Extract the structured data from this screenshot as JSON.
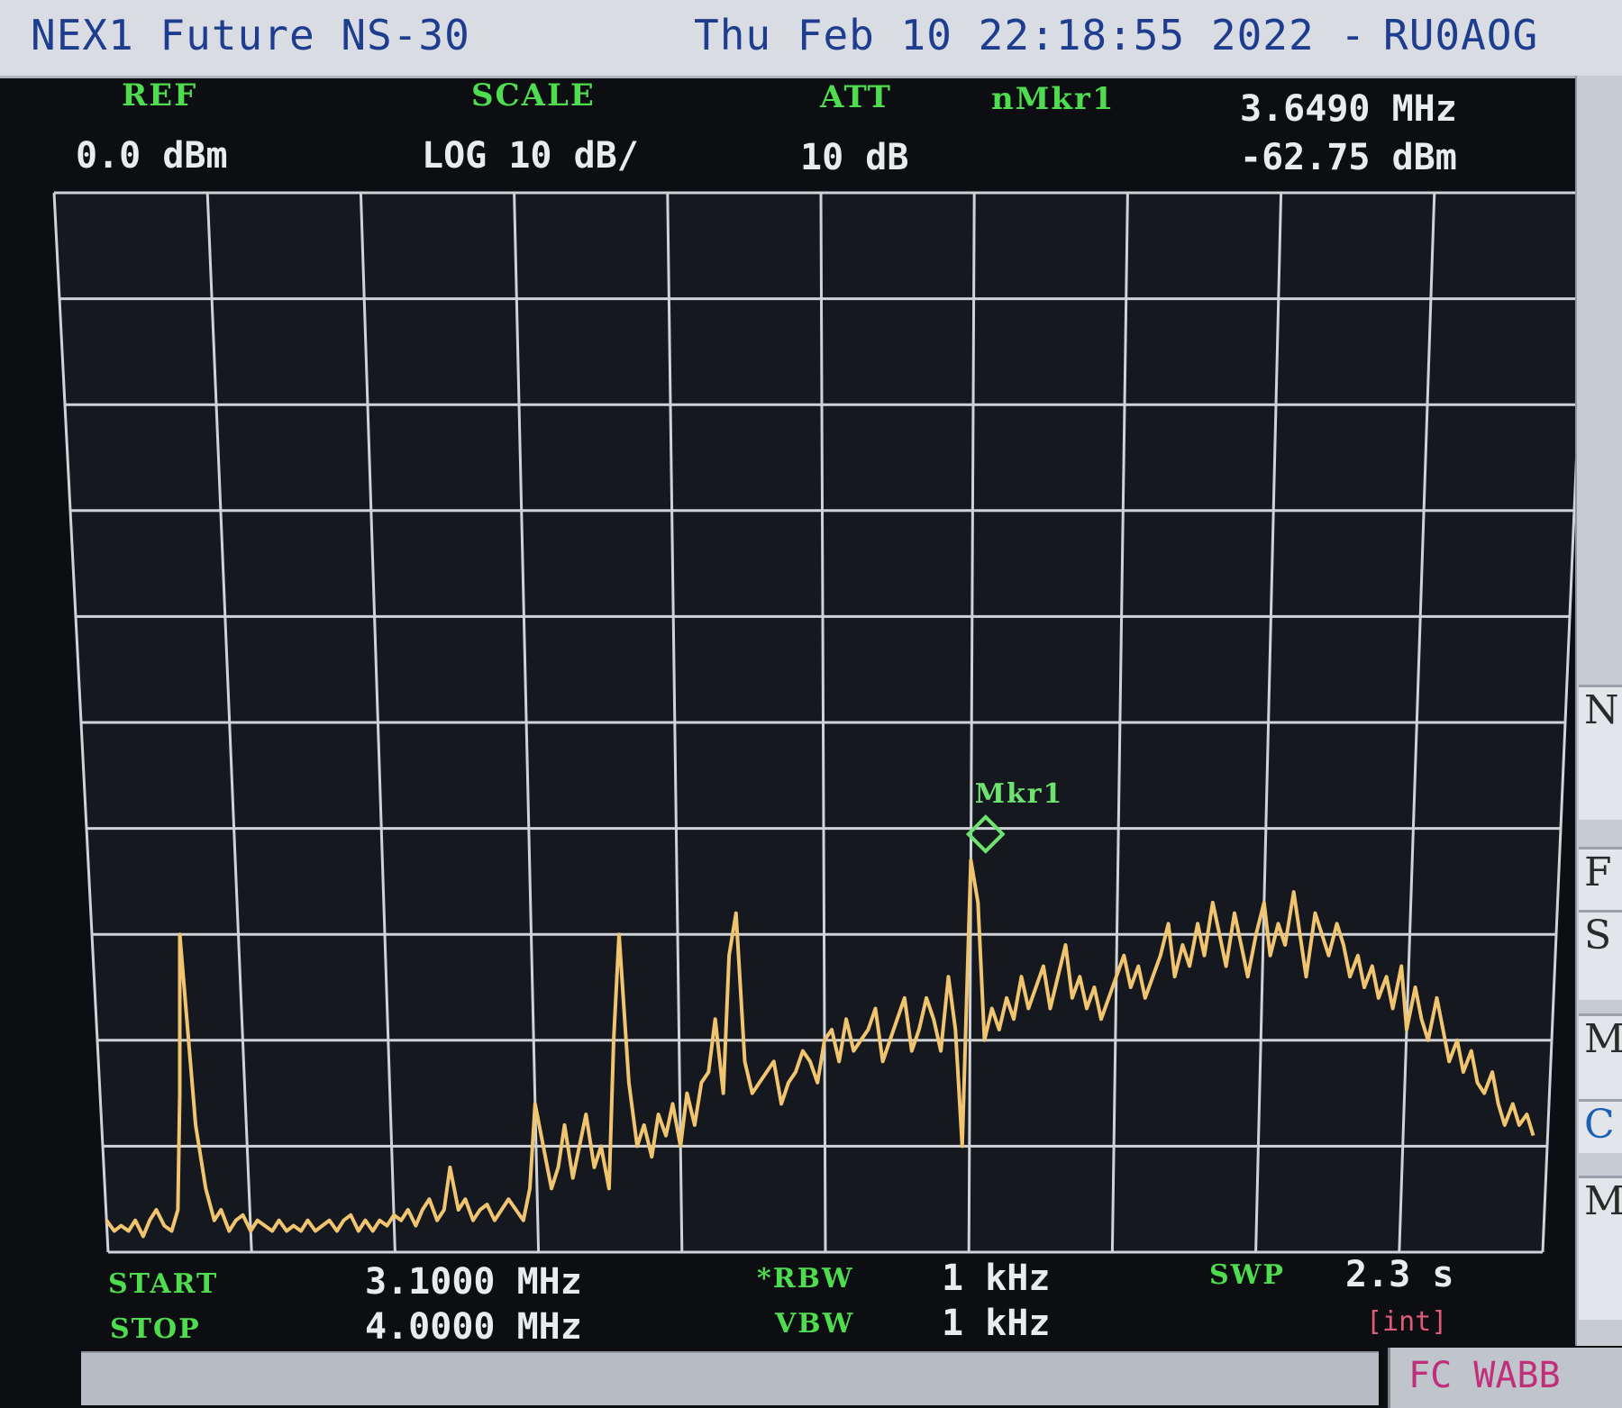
{
  "window": {
    "model": "NEX1 Future NS-30",
    "datetime": "Thu Feb 10 22:18:55 2022 -",
    "callsign": "RU0AOG"
  },
  "header": {
    "ref_label": "REF",
    "ref_value": "0.0 dBm",
    "scale_label": "SCALE",
    "scale_value": "LOG 10 dB/",
    "att_label": "ATT",
    "att_value": "10 dB",
    "marker_label": "nMkr1",
    "marker_freq": "3.6490 MHz",
    "marker_level": "-62.75 dBm"
  },
  "footer": {
    "start_label": "START",
    "start_value": "3.1000 MHz",
    "stop_label": "STOP",
    "stop_value": "4.0000 MHz",
    "rbw_label": "*RBW",
    "rbw_value": "1 kHz",
    "vbw_label": "VBW",
    "vbw_value": "1 kHz",
    "swp_label": "SWP",
    "swp_value": "2.3 s",
    "swp_mode": "[int]"
  },
  "softkeys": [
    "N",
    "F",
    "S",
    "M",
    "C",
    "Mo"
  ],
  "status_box": "FC WABB",
  "marker_tag": "Mkr1",
  "colors": {
    "trace": "#f1c470",
    "grid": "#cfd3d8",
    "label_green": "#4fdc4f",
    "marker": "#6fe36f"
  },
  "chart_data": {
    "type": "line",
    "x_unit": "MHz",
    "y_unit": "dBm",
    "xlim": [
      3.1,
      4.0
    ],
    "ylim": [
      -100,
      0
    ],
    "grid": true,
    "x": [
      3.1,
      3.1045,
      3.109,
      3.1135,
      3.118,
      3.1225,
      3.127,
      3.1315,
      3.136,
      3.1405,
      3.145,
      3.1495,
      3.154,
      3.1585,
      3.163,
      3.1675,
      3.172,
      3.1765,
      3.181,
      3.1855,
      3.19,
      3.1945,
      3.199,
      3.2035,
      3.208,
      3.2125,
      3.217,
      3.2215,
      3.226,
      3.2305,
      3.235,
      3.2395,
      3.244,
      3.2485,
      3.253,
      3.2575,
      3.262,
      3.2665,
      3.271,
      3.2755,
      3.28,
      3.2845,
      3.289,
      3.2935,
      3.298,
      3.3025,
      3.307,
      3.3115,
      3.316,
      3.3205,
      3.325,
      3.3295,
      3.334,
      3.3385,
      3.343,
      3.3475,
      3.352,
      3.3565,
      3.361,
      3.3655,
      3.37,
      3.3745,
      3.379,
      3.3835,
      3.388,
      3.3925,
      3.397,
      3.4015,
      3.406,
      3.4105,
      3.415,
      3.4195,
      3.424,
      3.4285,
      3.433,
      3.4375,
      3.442,
      3.4465,
      3.451,
      3.4555,
      3.46,
      3.4645,
      3.469,
      3.4735,
      3.478,
      3.4825,
      3.487,
      3.4915,
      3.496,
      3.5005,
      3.505,
      3.5095,
      3.514,
      3.5185,
      3.523,
      3.5275,
      3.532,
      3.5365,
      3.541,
      3.5455,
      3.55,
      3.5545,
      3.559,
      3.5635,
      3.568,
      3.5725,
      3.577,
      3.5815,
      3.586,
      3.5905,
      3.595,
      3.5995,
      3.604,
      3.6085,
      3.613,
      3.6175,
      3.622,
      3.6265,
      3.631,
      3.6355,
      3.64,
      3.6445,
      3.649,
      3.6535,
      3.658,
      3.6625,
      3.667,
      3.6715,
      3.676,
      3.6805,
      3.685,
      3.6895,
      3.694,
      3.6985,
      3.703,
      3.7075,
      3.712,
      3.7165,
      3.721,
      3.7255,
      3.73,
      3.7345,
      3.739,
      3.7435,
      3.748,
      3.7525,
      3.757,
      3.7615,
      3.766,
      3.7705,
      3.775,
      3.7795,
      3.784,
      3.7885,
      3.793,
      3.7975,
      3.802,
      3.8065,
      3.811,
      3.8155,
      3.82,
      3.8245,
      3.829,
      3.8335,
      3.838,
      3.8425,
      3.847,
      3.8515,
      3.856,
      3.8605,
      3.865,
      3.8695,
      3.874,
      3.8785,
      3.883,
      3.8875,
      3.892,
      3.8965,
      3.901,
      3.9055,
      3.91,
      3.9145,
      3.919,
      3.9235,
      3.928,
      3.9325,
      3.937,
      3.9415,
      3.946,
      3.9505,
      3.955,
      3.9595,
      3.964,
      3.9685,
      3.973,
      3.9775,
      3.982,
      3.9865,
      3.991,
      3.9955,
      4.0
    ],
    "y": [
      -97,
      -98,
      -97.5,
      -98,
      -97,
      -98.5,
      -97,
      -96,
      -97.5,
      -98,
      -96,
      -85,
      -70,
      -88,
      -94,
      -97,
      -96,
      -98,
      -97,
      -96.5,
      -98,
      -97,
      -97.5,
      -98,
      -97,
      -98,
      -97.5,
      -98,
      -97,
      -98,
      -97.5,
      -97,
      -98,
      -97,
      -96.5,
      -98,
      -97,
      -98,
      -97,
      -97.5,
      -96.5,
      -97,
      -96,
      -97.5,
      -96,
      -95,
      -97,
      -96,
      -92,
      -96,
      -95,
      -97,
      -96,
      -95.5,
      -97,
      -96,
      -95,
      -96,
      -97,
      -94,
      -86,
      -90,
      -94,
      -92,
      -88,
      -93,
      -90,
      -87,
      -92,
      -90,
      -94,
      -80,
      -70,
      -84,
      -90,
      -88,
      -91,
      -87,
      -89,
      -86,
      -90,
      -85,
      -88,
      -84,
      -83,
      -78,
      -85,
      -72,
      -68,
      -82,
      -85,
      -84,
      -83,
      -82,
      -86,
      -84,
      -83,
      -81,
      -82,
      -84,
      -80,
      -79,
      -82,
      -78,
      -81,
      -80,
      -79,
      -77,
      -82,
      -80,
      -78,
      -76,
      -81,
      -79,
      -76,
      -78,
      -81,
      -74,
      -79,
      -90,
      -63,
      -67,
      -80,
      -77,
      -79,
      -76,
      -78,
      -74,
      -77,
      -75,
      -73,
      -77,
      -74,
      -71,
      -76,
      -74,
      -77,
      -75,
      -78,
      -76,
      -74,
      -72,
      -75,
      -73,
      -76,
      -74,
      -72,
      -69,
      -74,
      -71,
      -73,
      -69,
      -72,
      -67,
      -70,
      -73,
      -68,
      -71,
      -74,
      -70,
      -67,
      -72,
      -69,
      -71,
      -66,
      -70,
      -74,
      -68,
      -70,
      -72,
      -69,
      -71,
      -74,
      -72,
      -75,
      -73,
      -76,
      -74,
      -77,
      -73,
      -79,
      -75,
      -78,
      -80,
      -76,
      -79,
      -82,
      -80,
      -83,
      -81,
      -84,
      -85,
      -83,
      -86,
      -88,
      -86,
      -88,
      -87,
      -89
    ],
    "marker": {
      "x": 3.649,
      "y": -62.75
    }
  }
}
